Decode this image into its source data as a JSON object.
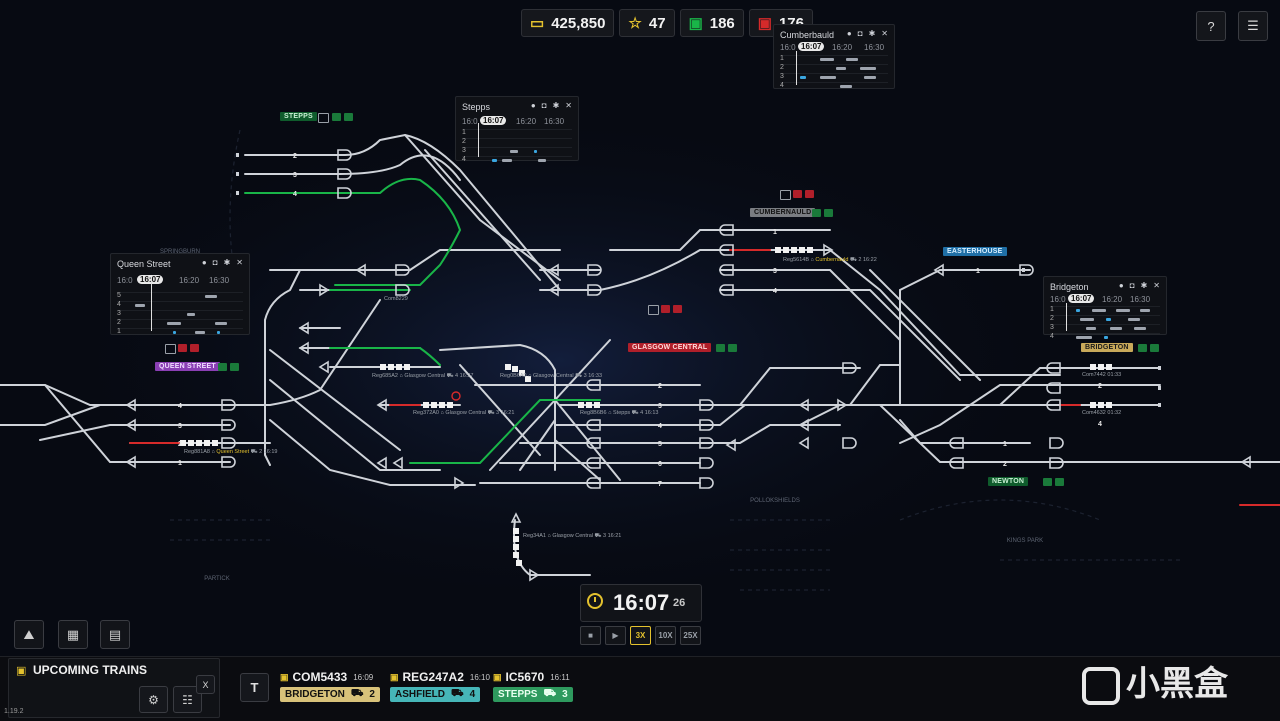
{
  "topbar": {
    "money": "425,850",
    "stars": "47",
    "trains_ok": "186",
    "trains_bad": "176",
    "money_icon": "wallet-icon",
    "star_icon": "star-icon",
    "train_ok_icon": "train-green-icon",
    "train_bad_icon": "train-red-icon"
  },
  "top_right": {
    "help_icon": "help-icon",
    "menu_icon": "list-menu-icon"
  },
  "panels": [
    {
      "title": "Cumberbauld",
      "times": [
        "16:0",
        "16:07",
        "16:20",
        "16:30"
      ],
      "rows": [
        "1",
        "2",
        "3",
        "4"
      ]
    },
    {
      "title": "Stepps",
      "times": [
        "16:0",
        "16:07",
        "16:20",
        "16:30"
      ],
      "rows": [
        "1",
        "2",
        "3",
        "4"
      ]
    },
    {
      "title": "Queen Street",
      "times": [
        "16:0",
        "16:07",
        "16:20",
        "16:30"
      ],
      "rows": [
        "5",
        "4",
        "3",
        "2",
        "1"
      ]
    },
    {
      "title": "Bridgeton",
      "times": [
        "16:0",
        "16:07",
        "16:20",
        "16:30"
      ],
      "rows": [
        "1",
        "2",
        "3",
        "4"
      ]
    }
  ],
  "stations": {
    "stepps": "STEPPS",
    "cumbernauld": "CUMBERNAULD",
    "queen_street": "QUEEN STREET",
    "glasgow_central": "GLASGOW CENTRAL",
    "easterhouse": "EASTERHOUSE",
    "bridgeton": "BRIDGETON",
    "newton": "NEWTON",
    "pollokshields": "POLLOKSHIELDS",
    "kings_park": "KINGS PARK",
    "partick": "PARTICK",
    "springburn": "SPRINGBURN"
  },
  "trains_on_map": [
    {
      "id": "Reg5614B",
      "dest": "Cumbernauld",
      "plat": "2",
      "time": "16:22"
    },
    {
      "id": "Com8229",
      "dest": "",
      "plat": "",
      "time": ""
    },
    {
      "id": "Reg685A2",
      "dest": "Glasgow Central",
      "plat": "4",
      "time": "16:27"
    },
    {
      "id": "Reg0B6A0",
      "dest": "Glasgow Central",
      "plat": "3",
      "time": "16:33"
    },
    {
      "id": "Reg372A0",
      "dest": "Glasgow Central",
      "plat": "3",
      "time": "16:21"
    },
    {
      "id": "Reg8B6B6",
      "dest": "Stepps",
      "plat": "4",
      "time": "16:13"
    },
    {
      "id": "Reg881A8",
      "dest": "Queen Street",
      "plat": "2",
      "time": "16:19"
    },
    {
      "id": "Reg34A1",
      "dest": "Glasgow Central",
      "plat": "3",
      "time": "16:21"
    },
    {
      "id": "Com7442",
      "dest": "",
      "plat": "",
      "time": "01:33"
    },
    {
      "id": "Com4632",
      "dest": "",
      "plat": "",
      "time": "01:32"
    }
  ],
  "platform_numbers": [
    "1",
    "2",
    "3",
    "4",
    "5",
    "6",
    "7"
  ],
  "clock": {
    "time": "16:07",
    "seconds": "26",
    "icon": "clock-icon"
  },
  "speed": {
    "pause_icon": "stop-icon",
    "play_icon": "play-icon",
    "options": [
      "3X",
      "10X",
      "25X"
    ],
    "active": "3X"
  },
  "left_tools": {
    "terrain_icon": "terrain-icon",
    "chip_icon": "chip-icon",
    "book_icon": "book-icon"
  },
  "upcoming": {
    "title": "UPCOMING TRAINS",
    "icon": "document-icon",
    "close": "X",
    "t_button": "T",
    "trains": [
      {
        "id": "COM5433",
        "time": "16:09",
        "dest": "BRIDGETON",
        "plat": "2",
        "color": "#d8c27a"
      },
      {
        "id": "REG247A2",
        "time": "16:10",
        "dest": "ASHFIELD",
        "plat": "4",
        "color": "#46b6b8"
      },
      {
        "id": "IC5670",
        "time": "16:11",
        "dest": "STEPPS",
        "plat": "3",
        "color": "#2e9a5e"
      }
    ]
  },
  "version": "1.19.2",
  "watermark": "小黑盒",
  "colors": {
    "track": "#cfd3d9",
    "route_green": "#19b548",
    "route_red": "#d62a2a",
    "accent_yellow": "#e4c22e",
    "station_green": "#0f5c2c",
    "station_blue": "#1f6fa6",
    "station_red": "#b01f2a",
    "station_purple": "#8a3fb4",
    "station_grey": "#7a7d82",
    "station_tan": "#c8a95a"
  }
}
